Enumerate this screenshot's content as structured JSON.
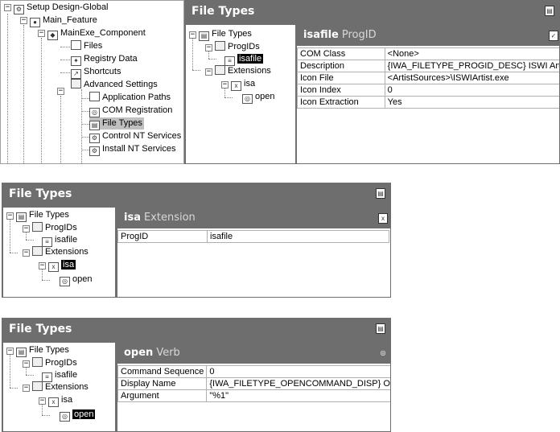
{
  "top": {
    "tree": {
      "root": "Setup Design-Global",
      "feature": "Main_Feature",
      "component": "MainExe_Component",
      "items": [
        "Files",
        "Registry Data",
        "Shortcuts",
        "Advanced Settings"
      ],
      "advanced": [
        "Application Paths",
        "COM Registration",
        "File Types",
        "Control NT Services",
        "Install NT Services"
      ]
    },
    "header": "File Types",
    "subtree": {
      "root": "File Types",
      "progids": "ProgIDs",
      "isafile": "isafile",
      "extensions": "Extensions",
      "isa": "isa",
      "open": "open"
    },
    "detail": {
      "name": "isafile",
      "type": "ProgID",
      "rows": [
        [
          "COM Class",
          "<None>"
        ],
        [
          "Description",
          "{IWA_FILETYPE_PROGID_DESC} ISWI Artis"
        ],
        [
          "Icon File",
          "<ArtistSources>\\ISWIArtist.exe"
        ],
        [
          "Icon Index",
          "0"
        ],
        [
          "Icon Extraction",
          "Yes"
        ]
      ]
    }
  },
  "mid": {
    "header": "File Types",
    "subtree": {
      "root": "File Types",
      "progids": "ProgIDs",
      "isafile": "isafile",
      "extensions": "Extensions",
      "isa": "isa",
      "open": "open"
    },
    "detail": {
      "name": "isa",
      "type": "Extension",
      "rows": [
        [
          "ProgID",
          "isafile"
        ]
      ]
    }
  },
  "bot": {
    "header": "File Types",
    "subtree": {
      "root": "File Types",
      "progids": "ProgIDs",
      "isafile": "isafile",
      "extensions": "Extensions",
      "isa": "isa",
      "open": "open"
    },
    "detail": {
      "name": "open",
      "type": "Verb",
      "rows": [
        [
          "Command Sequence",
          "0"
        ],
        [
          "Display Name",
          "{IWA_FILETYPE_OPENCOMMAND_DISP} Ope"
        ],
        [
          "Argument",
          "\"%1\""
        ]
      ]
    }
  }
}
